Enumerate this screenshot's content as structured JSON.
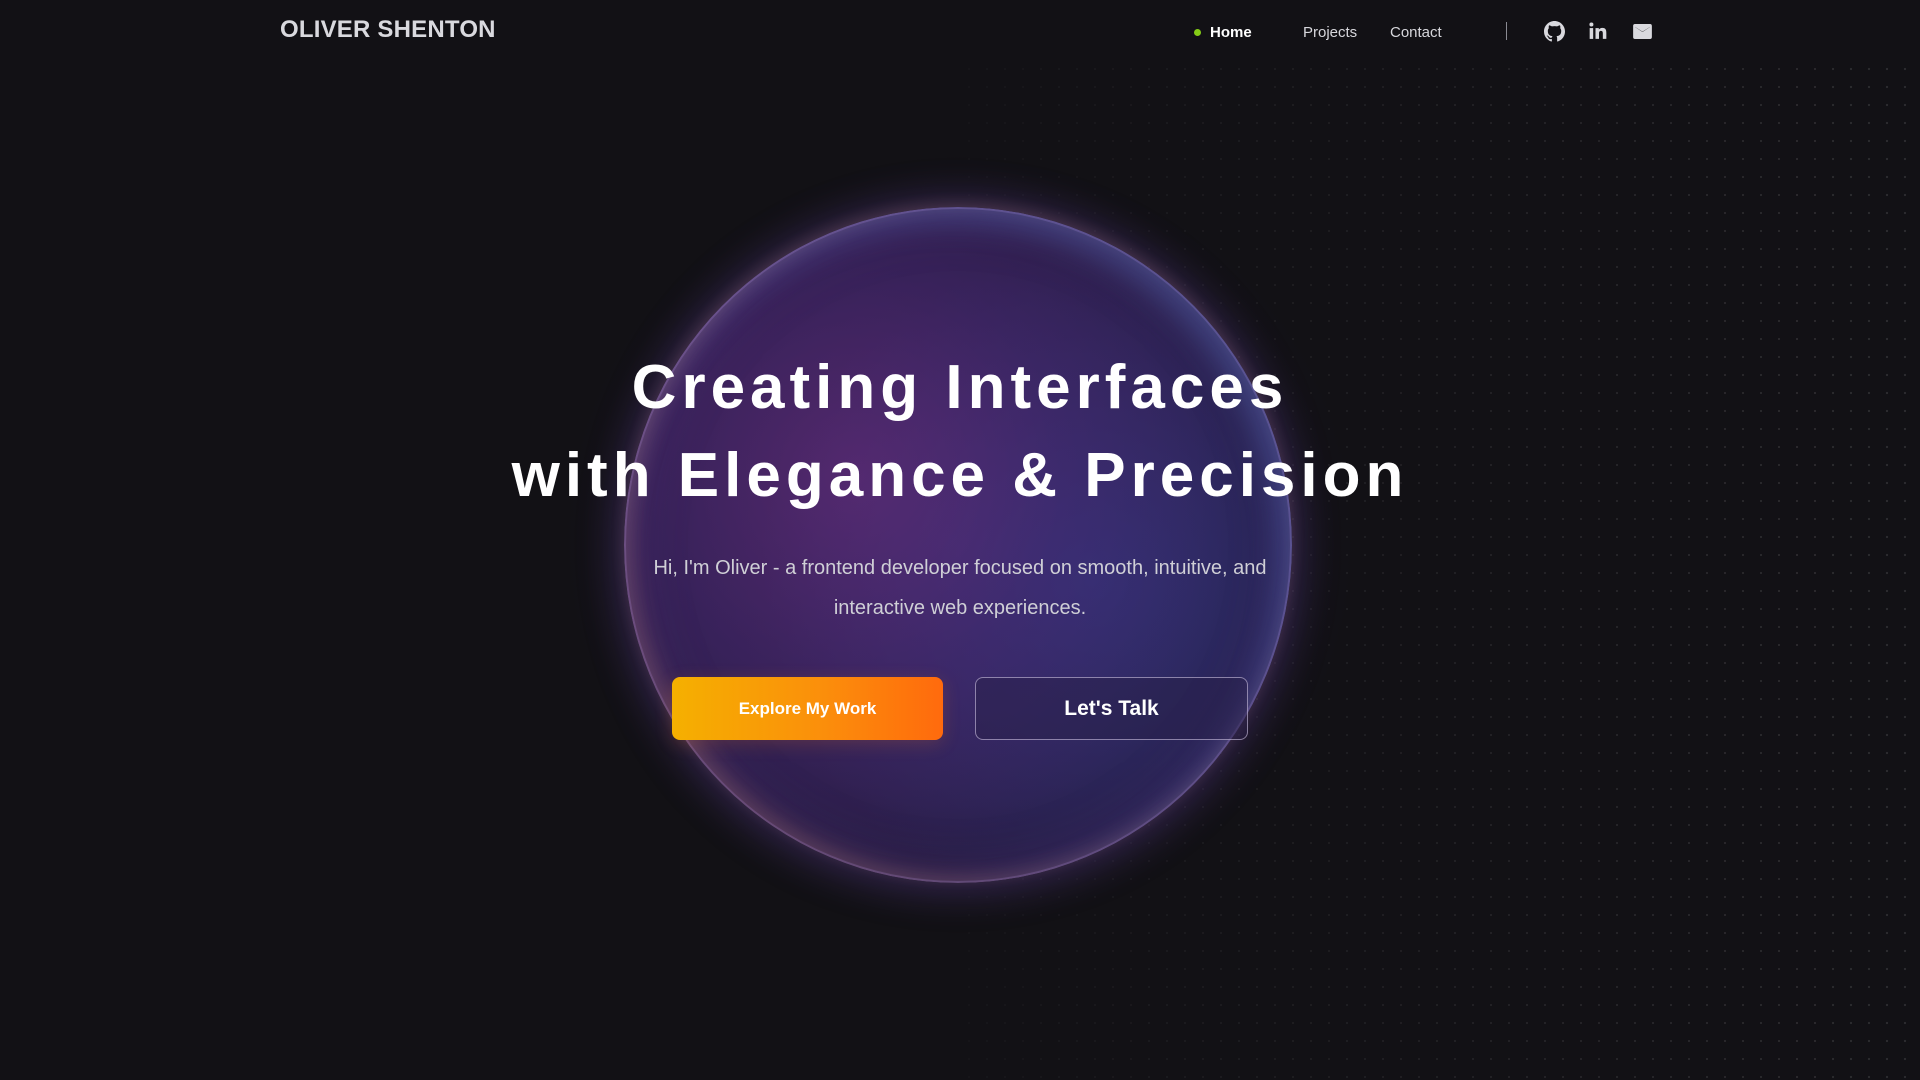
{
  "brand": {
    "name": "OLIVER SHENTON"
  },
  "nav": {
    "links": [
      {
        "label": "Home",
        "active": true
      },
      {
        "label": "Projects",
        "active": false
      },
      {
        "label": "Contact",
        "active": false
      }
    ],
    "active_indicator_color": "#84cc16",
    "social_icons": [
      "github-icon",
      "linkedin-icon",
      "mail-icon"
    ]
  },
  "hero": {
    "title_line1": "Creating Interfaces",
    "title_line2": "with Elegance & Precision",
    "subtitle_line1": "Hi, I'm Oliver - a frontend developer focused on smooth, intuitive, and",
    "subtitle_line2": "interactive web experiences.",
    "primary_button": "Explore My Work",
    "secondary_button": "Let's Talk"
  },
  "colors": {
    "background": "#121115",
    "primary_gradient_start": "#f5b000",
    "primary_gradient_end": "#ff6a0d",
    "orb": "#2c1f4b"
  }
}
